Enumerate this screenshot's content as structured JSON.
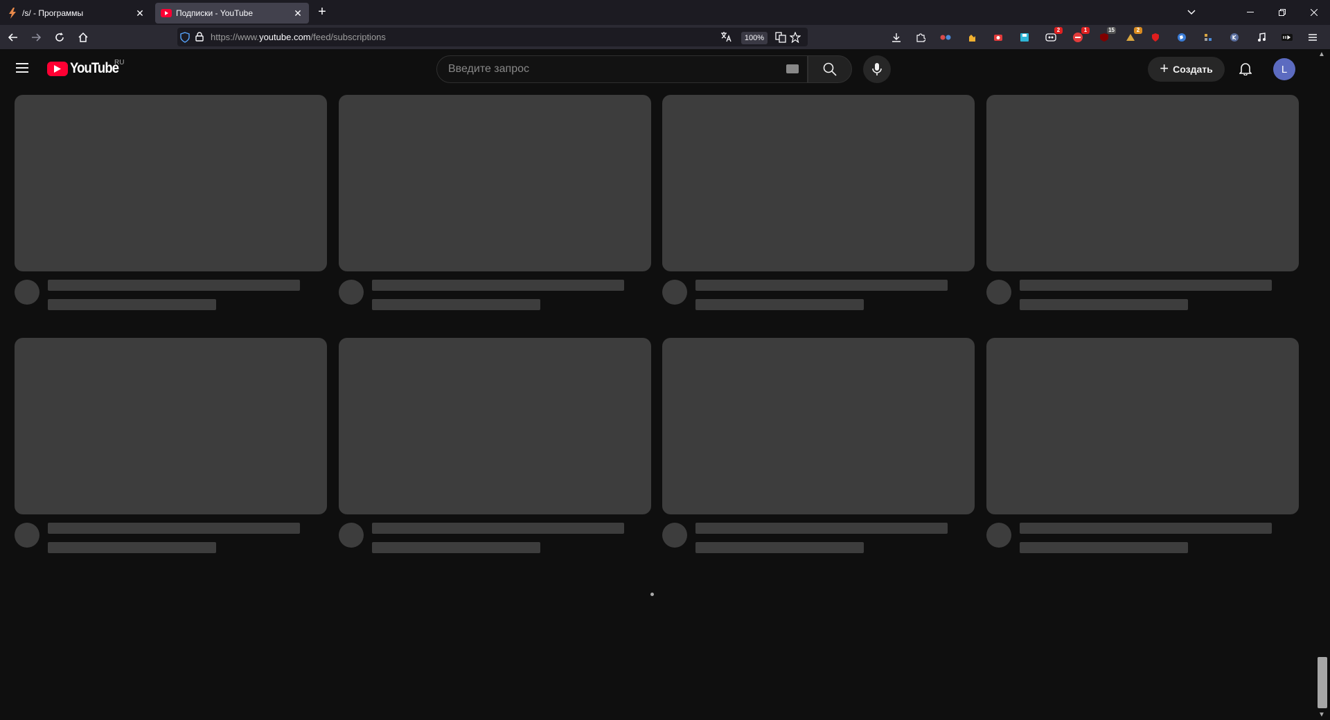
{
  "browser": {
    "tabs": [
      {
        "title": "/s/ - Программы",
        "active": false
      },
      {
        "title": "Подписки - YouTube",
        "active": true
      }
    ],
    "url_prefix": "https://www.",
    "url_domain": "youtube.com",
    "url_path": "/feed/subscriptions",
    "zoom": "100%",
    "badges": {
      "ext1": "2",
      "ext2": "1",
      "ext3": "15",
      "ext4": "2"
    }
  },
  "youtube": {
    "logo_text": "YouTube",
    "region": "RU",
    "search_placeholder": "Введите запрос",
    "create_label": "Создать",
    "avatar_letter": "L"
  },
  "colors": {
    "background": "#0f0f0f",
    "skeleton": "#3d3d3d",
    "brand_red": "#ff0033",
    "avatar": "#5c6bc0"
  },
  "feed": {
    "state": "loading",
    "skeleton_cards": 8
  }
}
